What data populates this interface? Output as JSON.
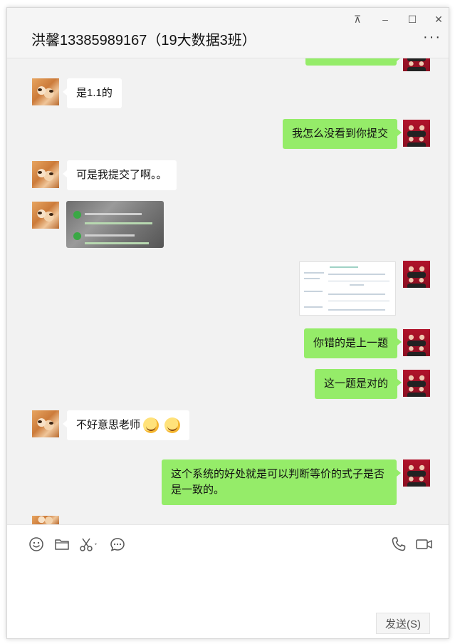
{
  "window": {
    "title": "洪馨13385989167（19大数据3班）",
    "controls": {
      "pin": "⊼",
      "minimize": "–",
      "maximize": "☐",
      "close": "✕"
    },
    "more": "···"
  },
  "messages": [
    {
      "side": "left",
      "type": "text",
      "text": "是1.1的"
    },
    {
      "side": "right",
      "type": "text",
      "text": "我怎么没看到你提交"
    },
    {
      "side": "left",
      "type": "text",
      "text": "可是我提交了啊。。"
    },
    {
      "side": "left",
      "type": "image"
    },
    {
      "side": "right",
      "type": "image"
    },
    {
      "side": "right",
      "type": "text",
      "text": "你错的是上一题"
    },
    {
      "side": "right",
      "type": "text",
      "text": "这一题是对的"
    },
    {
      "side": "left",
      "type": "text",
      "text": "不好意思老师",
      "emoji": [
        "grinning-sweat-emoji",
        "grinning-sweat-emoji"
      ]
    },
    {
      "side": "right",
      "type": "text",
      "text": "这个系统的好处就是可以判断等价的式子是否是一致的。"
    }
  ],
  "toolbar": {
    "icons": [
      "emoji-icon",
      "folder-icon",
      "scissors-icon",
      "chat-history-icon",
      "phone-icon",
      "video-call-icon"
    ]
  },
  "input": {
    "value": ""
  },
  "send_label": "发送(S)",
  "colors": {
    "sent_bubble": "#95ec69",
    "received_bubble": "#ffffff",
    "chat_bg": "#f2f2f2"
  }
}
